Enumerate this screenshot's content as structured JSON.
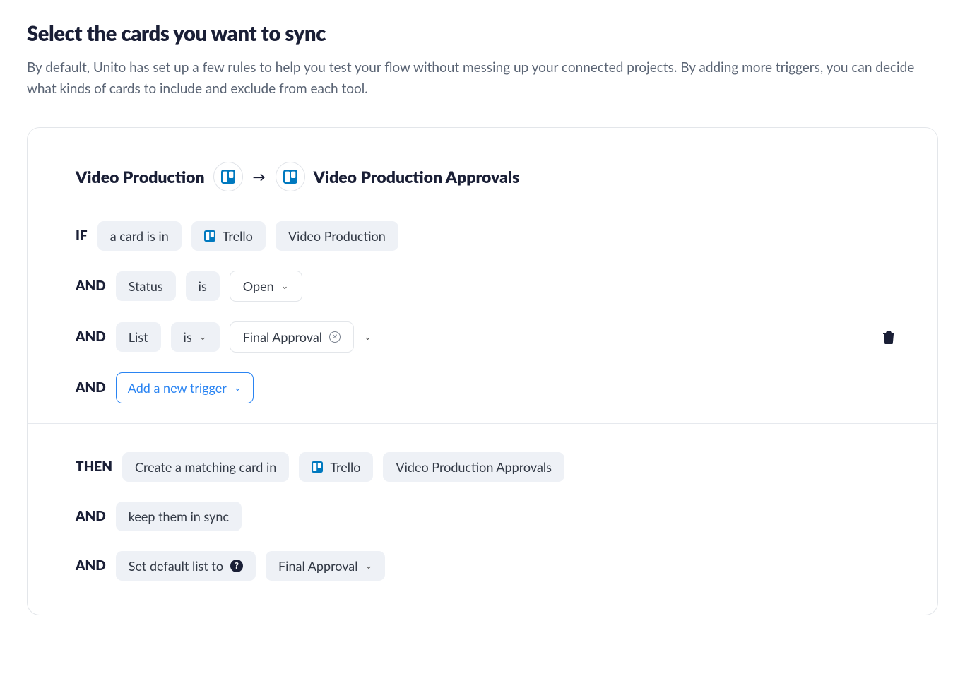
{
  "header": {
    "title": "Select the cards you want to sync",
    "subtitle": "By default, Unito has set up a few rules to help you test your flow without messing up your connected projects. By adding more triggers, you can decide what kinds of cards to include and exclude from each tool."
  },
  "flow": {
    "source_name": "Video Production",
    "target_name": "Video Production Approvals"
  },
  "rules": {
    "if_kw": "IF",
    "and_kw": "AND",
    "then_kw": "THEN",
    "card_is_in": "a card is in",
    "trello": "Trello",
    "source_board": "Video Production",
    "status_field": "Status",
    "is_op": "is",
    "status_value": "Open",
    "list_field": "List",
    "list_value": "Final Approval",
    "add_trigger": "Add a new trigger",
    "create_matching": "Create a matching card in",
    "target_board": "Video Production Approvals",
    "keep_sync": "keep them in sync",
    "set_default_list": "Set default list to",
    "default_list_value": "Final Approval"
  }
}
